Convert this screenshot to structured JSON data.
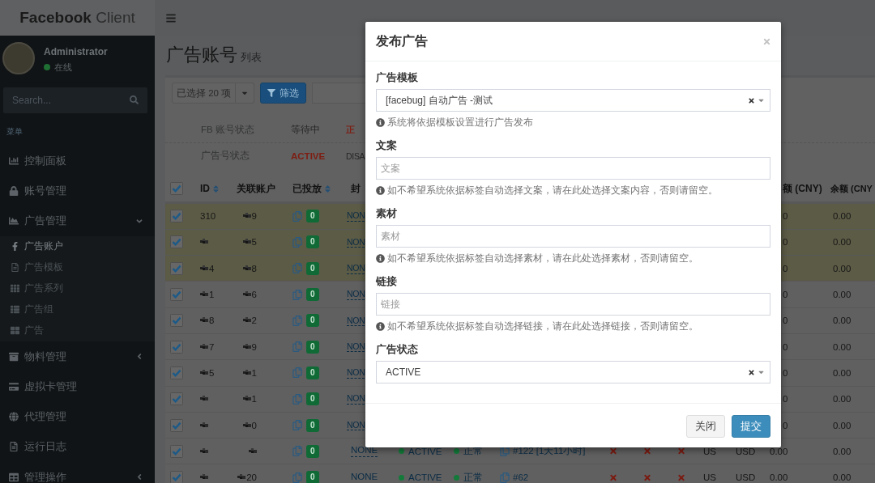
{
  "header": {
    "brand": "**Facebook** Client"
  },
  "sidebar": {
    "user": {
      "name": "Administrator",
      "status": "在线",
      "online": true
    },
    "search": {
      "placeholder": "Search..."
    },
    "menu_header": "菜单",
    "items": [
      {
        "label": "控制面板"
      },
      {
        "label": "账号管理"
      },
      {
        "label": "广告管理",
        "expanded": true,
        "children": [
          {
            "label": "广告账户",
            "selected": true
          },
          {
            "label": "广告模板",
            "selected": false
          },
          {
            "label": "广告系列",
            "selected": false
          },
          {
            "label": "广告组",
            "selected": false
          },
          {
            "label": "广告",
            "selected": false
          }
        ]
      },
      {
        "label": "物料管理",
        "expanded": false
      },
      {
        "label": "虚拟卡管理"
      },
      {
        "label": "代理管理"
      },
      {
        "label": "运行日志"
      },
      {
        "label": "管理操作",
        "expanded": false
      }
    ]
  },
  "page": {
    "title": "广告账号",
    "subtitle": "列表"
  },
  "toolbar": {
    "multiselect": "已选择 20 项",
    "filter_button": "筛选"
  },
  "filters": [
    {
      "label": "FB 账号状态",
      "options": [
        {
          "label": "等待中",
          "selected": false
        },
        {
          "label": "正",
          "selected": true
        }
      ]
    },
    {
      "label": "广告号状态",
      "options": [
        {
          "label": "ACTIVE",
          "selected": true
        },
        {
          "label": "DISA",
          "selected": false
        }
      ]
    }
  ],
  "table": {
    "all_checked": true,
    "columns": [
      {
        "label": "ID",
        "sortable": true
      },
      {
        "label": "关联账户",
        "sortable": false
      },
      {
        "label": "已投放",
        "sortable": true
      },
      {
        "label": "封",
        "sortable": false
      },
      {
        "label": "额 (CNY)",
        "sortable": false
      },
      {
        "label": "余额 (CNY",
        "sortable": false
      }
    ],
    "rows": [
      {
        "checked": true,
        "highlighted": true,
        "id": {
          "masked": false,
          "text": "310"
        },
        "account": {
          "masked": true,
          "text": "9"
        },
        "delivered": "0",
        "ban": "NON",
        "amount": "0",
        "balance": "0.00"
      },
      {
        "checked": true,
        "highlighted": true,
        "id": {
          "masked": true
        },
        "account": {
          "masked": true,
          "text": "5"
        },
        "delivered": "0",
        "ban": "NON",
        "amount": "0",
        "balance": "0.00"
      },
      {
        "checked": true,
        "highlighted": true,
        "id": {
          "masked": true,
          "text": "4"
        },
        "account": {
          "masked": true,
          "text": "8"
        },
        "delivered": "0",
        "ban": "NON",
        "amount": "0",
        "balance": "0.00"
      },
      {
        "checked": true,
        "highlighted": false,
        "id": {
          "masked": true,
          "text": "1"
        },
        "account": {
          "masked": true,
          "text": "6"
        },
        "delivered": "0",
        "ban": "NON",
        "amount": "0",
        "balance": "0.00"
      },
      {
        "checked": true,
        "highlighted": false,
        "id": {
          "masked": true,
          "text": "8"
        },
        "account": {
          "masked": true,
          "text": "2"
        },
        "delivered": "0",
        "ban": "NON",
        "amount": "0",
        "balance": "0.00"
      },
      {
        "checked": true,
        "highlighted": false,
        "id": {
          "masked": true,
          "text": "7"
        },
        "account": {
          "masked": true,
          "text": "9"
        },
        "delivered": "0",
        "ban": "NON",
        "amount": "0",
        "balance": "0.00"
      },
      {
        "checked": true,
        "highlighted": false,
        "id": {
          "masked": true,
          "text": "5"
        },
        "account": {
          "masked": true,
          "text": "1"
        },
        "delivered": "0",
        "ban": "NON",
        "amount": "0",
        "balance": "0.00"
      },
      {
        "checked": true,
        "highlighted": false,
        "id": {
          "masked": true
        },
        "account": {
          "masked": true,
          "text": "1"
        },
        "delivered": "0",
        "ban": "NON",
        "amount": "0",
        "balance": "0.00"
      },
      {
        "checked": true,
        "highlighted": false,
        "id": {
          "masked": true
        },
        "account": {
          "masked": true,
          "text": "0"
        },
        "delivered": "0",
        "ban": "NON",
        "amount": "0",
        "balance": "0.00"
      },
      {
        "checked": true,
        "highlighted": false,
        "id": {
          "masked": true
        },
        "account": {
          "masked": true
        },
        "delivered": "0",
        "ban": "NONE",
        "ad_status": "ACTIVE",
        "account_status": "正常",
        "campaign": "#122 [1天11小时]",
        "flags": [
          false,
          false,
          false
        ],
        "country": "US",
        "currency": "USD",
        "amount": "0.00",
        "balance": "0.00"
      },
      {
        "checked": true,
        "highlighted": false,
        "id": {
          "masked": true
        },
        "account": {
          "masked": true,
          "text": "20"
        },
        "delivered": "0",
        "ban": "NONE",
        "ad_status": "ACTIVE",
        "account_status": "正常",
        "campaign": "#62",
        "flags": [
          false,
          false,
          false
        ],
        "country": "US",
        "currency": "USD",
        "amount": "0.00",
        "balance": "0.00"
      }
    ]
  },
  "modal": {
    "title": "发布广告",
    "fields": [
      {
        "kind": "select",
        "label": "广告模板",
        "value": "[facebug] 自动广告 -测试",
        "help": "系统将依据模板设置进行广告发布"
      },
      {
        "kind": "input",
        "label": "文案",
        "placeholder": "文案",
        "help": "如不希望系统依据标签自动选择文案，请在此处选择文案内容，否则请留空。"
      },
      {
        "kind": "input",
        "label": "素材",
        "placeholder": "素材",
        "help": "如不希望系统依据标签自动选择素材，请在此处选择素材，否则请留空。"
      },
      {
        "kind": "input",
        "label": "链接",
        "placeholder": "链接",
        "help": "如不希望系统依据标签自动选择链接，请在此处选择链接，否则请留空。"
      },
      {
        "kind": "select",
        "label": "广告状态",
        "value": "ACTIVE"
      }
    ],
    "buttons": [
      {
        "label": "关闭",
        "kind": "default"
      },
      {
        "label": "提交",
        "kind": "primary"
      }
    ]
  }
}
